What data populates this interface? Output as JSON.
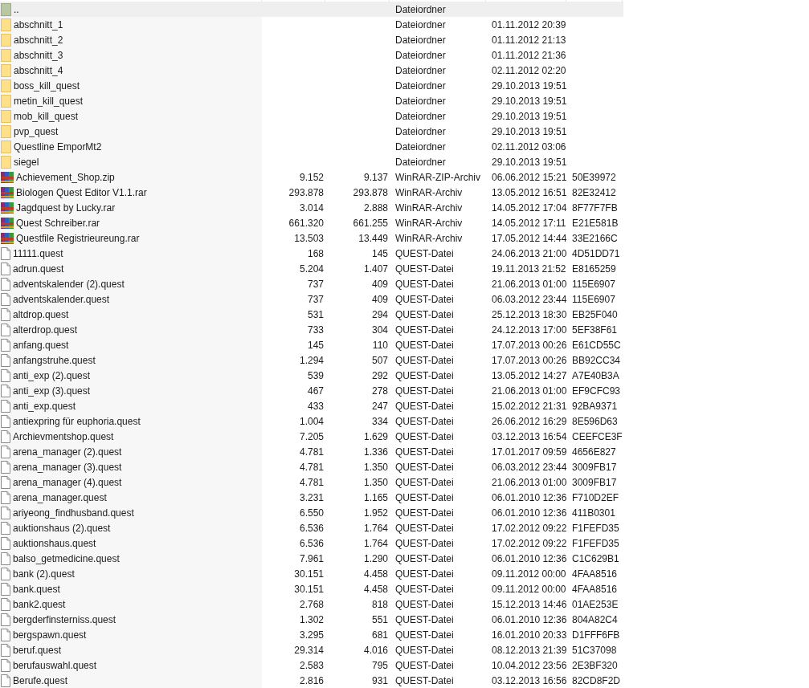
{
  "rows": [
    {
      "kind": "parent",
      "name": "..",
      "type": "Dateiordner",
      "selected": true
    },
    {
      "kind": "folder",
      "name": "abschnitt_1",
      "type": "Dateiordner",
      "modified": "01.11.2012 20:39",
      "selected": false
    },
    {
      "kind": "folder",
      "name": "abschnitt_2",
      "type": "Dateiordner",
      "modified": "01.11.2012 21:13",
      "selected": false
    },
    {
      "kind": "folder",
      "name": "abschnitt_3",
      "type": "Dateiordner",
      "modified": "01.11.2012 21:36",
      "selected": false
    },
    {
      "kind": "folder",
      "name": "abschnitt_4",
      "type": "Dateiordner",
      "modified": "02.11.2012 02:20",
      "selected": false
    },
    {
      "kind": "folder",
      "name": "boss_kill_quest",
      "type": "Dateiordner",
      "modified": "29.10.2013 19:51",
      "selected": false
    },
    {
      "kind": "folder",
      "name": "metin_kill_quest",
      "type": "Dateiordner",
      "modified": "29.10.2013 19:51",
      "selected": false
    },
    {
      "kind": "folder",
      "name": "mob_kill_quest",
      "type": "Dateiordner",
      "modified": "29.10.2013 19:51",
      "selected": false
    },
    {
      "kind": "folder",
      "name": "pvp_quest",
      "type": "Dateiordner",
      "modified": "29.10.2013 19:51",
      "selected": false
    },
    {
      "kind": "folder",
      "name": "Questline EmporMt2",
      "type": "Dateiordner",
      "modified": "02.11.2012 03:06",
      "selected": false
    },
    {
      "kind": "folder",
      "name": "siegel",
      "type": "Dateiordner",
      "modified": "29.10.2013 19:51",
      "selected": false
    },
    {
      "kind": "archive",
      "name": "Achievement_Shop.zip",
      "size": "9.152",
      "packed": "9.137",
      "type": "WinRAR-ZIP-Archiv",
      "modified": "06.06.2012 15:21",
      "crc": "50E39972",
      "selected": false
    },
    {
      "kind": "archive",
      "name": "Biologen Quest Editor V1.1.rar",
      "size": "293.878",
      "packed": "293.878",
      "type": "WinRAR-Archiv",
      "modified": "13.05.2012 16:51",
      "crc": "82E32412",
      "selected": false
    },
    {
      "kind": "archive",
      "name": "Jagdquest by Lucky.rar",
      "size": "3.014",
      "packed": "2.888",
      "type": "WinRAR-Archiv",
      "modified": "14.05.2012 17:04",
      "crc": "8F77F7FB",
      "selected": false
    },
    {
      "kind": "archive",
      "name": "Quest Schreiber.rar",
      "size": "661.320",
      "packed": "661.255",
      "type": "WinRAR-Archiv",
      "modified": "14.05.2012 17:11",
      "crc": "E21E581B",
      "selected": false
    },
    {
      "kind": "archive",
      "name": "Questfile Registrieureung.rar",
      "size": "13.503",
      "packed": "13.449",
      "type": "WinRAR-Archiv",
      "modified": "17.05.2012 14:44",
      "crc": "33E2166C",
      "selected": false
    },
    {
      "kind": "file",
      "name": "11111.quest",
      "size": "168",
      "packed": "145",
      "type": "QUEST-Datei",
      "modified": "24.06.2013 21:00",
      "crc": "4D51DD71",
      "selected": false
    },
    {
      "kind": "file",
      "name": "adrun.quest",
      "size": "5.204",
      "packed": "1.407",
      "type": "QUEST-Datei",
      "modified": "19.11.2013 21:52",
      "crc": "E8165259",
      "selected": false
    },
    {
      "kind": "file",
      "name": "adventskalender (2).quest",
      "size": "737",
      "packed": "409",
      "type": "QUEST-Datei",
      "modified": "21.06.2013 01:00",
      "crc": "115E6907",
      "selected": false
    },
    {
      "kind": "file",
      "name": "adventskalender.quest",
      "size": "737",
      "packed": "409",
      "type": "QUEST-Datei",
      "modified": "06.03.2012 23:44",
      "crc": "115E6907",
      "selected": false
    },
    {
      "kind": "file",
      "name": "altdrop.quest",
      "size": "531",
      "packed": "294",
      "type": "QUEST-Datei",
      "modified": "25.12.2013 18:30",
      "crc": "EB25F040",
      "selected": false
    },
    {
      "kind": "file",
      "name": "alterdrop.quest",
      "size": "733",
      "packed": "304",
      "type": "QUEST-Datei",
      "modified": "24.12.2013 17:00",
      "crc": "5EF38F61",
      "selected": false
    },
    {
      "kind": "file",
      "name": "anfang.quest",
      "size": "145",
      "packed": "110",
      "type": "QUEST-Datei",
      "modified": "17.07.2013 00:26",
      "crc": "E61CD55C",
      "selected": false
    },
    {
      "kind": "file",
      "name": "anfangstruhe.quest",
      "size": "1.294",
      "packed": "507",
      "type": "QUEST-Datei",
      "modified": "17.07.2013 00:26",
      "crc": "BB92CC34",
      "selected": false
    },
    {
      "kind": "file",
      "name": "anti_exp (2).quest",
      "size": "539",
      "packed": "292",
      "type": "QUEST-Datei",
      "modified": "13.05.2012 14:27",
      "crc": "A7E40B3A",
      "selected": false
    },
    {
      "kind": "file",
      "name": "anti_exp (3).quest",
      "size": "467",
      "packed": "278",
      "type": "QUEST-Datei",
      "modified": "21.06.2013 01:00",
      "crc": "EF9CFC93",
      "selected": false
    },
    {
      "kind": "file",
      "name": "anti_exp.quest",
      "size": "433",
      "packed": "247",
      "type": "QUEST-Datei",
      "modified": "15.02.2012 21:31",
      "crc": "92BA9371",
      "selected": false
    },
    {
      "kind": "file",
      "name": "antiexpring für euphoria.quest",
      "size": "1.004",
      "packed": "334",
      "type": "QUEST-Datei",
      "modified": "26.06.2012 16:29",
      "crc": "8E596D63",
      "selected": false
    },
    {
      "kind": "file",
      "name": "Archievmentshop.quest",
      "size": "7.205",
      "packed": "1.629",
      "type": "QUEST-Datei",
      "modified": "03.12.2013 16:54",
      "crc": "CEEFCE3F",
      "selected": false
    },
    {
      "kind": "file",
      "name": "arena_manager (2).quest",
      "size": "4.781",
      "packed": "1.336",
      "type": "QUEST-Datei",
      "modified": "17.01.2017 09:59",
      "crc": "4656E827",
      "selected": false
    },
    {
      "kind": "file",
      "name": "arena_manager (3).quest",
      "size": "4.781",
      "packed": "1.350",
      "type": "QUEST-Datei",
      "modified": "06.03.2012 23:44",
      "crc": "3009FB17",
      "selected": false
    },
    {
      "kind": "file",
      "name": "arena_manager (4).quest",
      "size": "4.781",
      "packed": "1.350",
      "type": "QUEST-Datei",
      "modified": "21.06.2013 01:00",
      "crc": "3009FB17",
      "selected": false
    },
    {
      "kind": "file",
      "name": "arena_manager.quest",
      "size": "3.231",
      "packed": "1.165",
      "type": "QUEST-Datei",
      "modified": "06.01.2010 12:36",
      "crc": "F710D2EF",
      "selected": false
    },
    {
      "kind": "file",
      "name": "ariyeong_findhusband.quest",
      "size": "6.550",
      "packed": "1.952",
      "type": "QUEST-Datei",
      "modified": "06.01.2010 12:36",
      "crc": "411B0301",
      "selected": false
    },
    {
      "kind": "file",
      "name": "auktionshaus (2).quest",
      "size": "6.536",
      "packed": "1.764",
      "type": "QUEST-Datei",
      "modified": "17.02.2012 09:22",
      "crc": "F1FEFD35",
      "selected": false
    },
    {
      "kind": "file",
      "name": "auktionshaus.quest",
      "size": "6.536",
      "packed": "1.764",
      "type": "QUEST-Datei",
      "modified": "17.02.2012 09:22",
      "crc": "F1FEFD35",
      "selected": false
    },
    {
      "kind": "file",
      "name": "balso_getmedicine.quest",
      "size": "7.961",
      "packed": "1.290",
      "type": "QUEST-Datei",
      "modified": "06.01.2010 12:36",
      "crc": "C1C629B1",
      "selected": false
    },
    {
      "kind": "file",
      "name": "bank (2).quest",
      "size": "30.151",
      "packed": "4.458",
      "type": "QUEST-Datei",
      "modified": "09.11.2012 00:00",
      "crc": "4FAA8516",
      "selected": false
    },
    {
      "kind": "file",
      "name": "bank.quest",
      "size": "30.151",
      "packed": "4.458",
      "type": "QUEST-Datei",
      "modified": "09.11.2012 00:00",
      "crc": "4FAA8516",
      "selected": false
    },
    {
      "kind": "file",
      "name": "bank2.quest",
      "size": "2.768",
      "packed": "818",
      "type": "QUEST-Datei",
      "modified": "15.12.2013 14:46",
      "crc": "01AE253E",
      "selected": false
    },
    {
      "kind": "file",
      "name": "bergderfinsterniss.quest",
      "size": "1.302",
      "packed": "551",
      "type": "QUEST-Datei",
      "modified": "06.01.2010 12:36",
      "crc": "804A82C4",
      "selected": false
    },
    {
      "kind": "file",
      "name": "bergspawn.quest",
      "size": "3.295",
      "packed": "681",
      "type": "QUEST-Datei",
      "modified": "16.01.2010 20:33",
      "crc": "D1FFF6FB",
      "selected": false
    },
    {
      "kind": "file",
      "name": "beruf.quest",
      "size": "29.314",
      "packed": "4.016",
      "type": "QUEST-Datei",
      "modified": "08.12.2013 21:39",
      "crc": "51C37098",
      "selected": false
    },
    {
      "kind": "file",
      "name": "berufauswahl.quest",
      "size": "2.583",
      "packed": "795",
      "type": "QUEST-Datei",
      "modified": "10.04.2012 23:56",
      "crc": "2E3BF320",
      "selected": false
    },
    {
      "kind": "file",
      "name": "Berufe.quest",
      "size": "2.816",
      "packed": "931",
      "type": "QUEST-Datei",
      "modified": "03.12.2013 16:56",
      "crc": "82CD8F2D",
      "selected": false
    }
  ]
}
